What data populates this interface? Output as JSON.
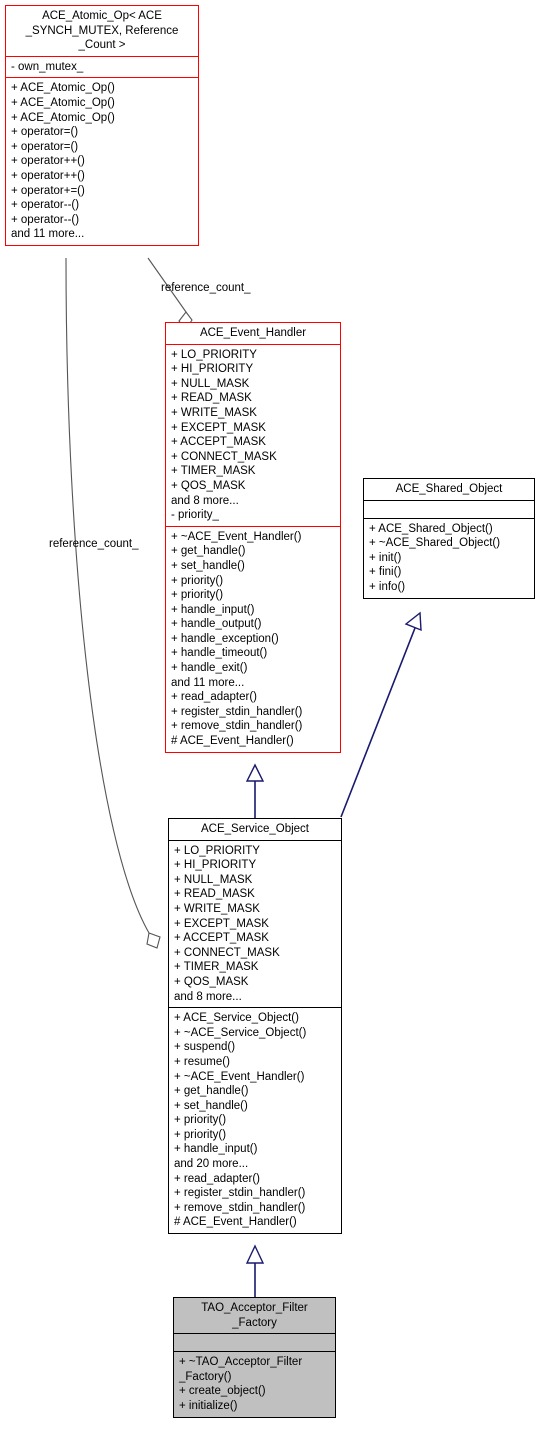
{
  "diagram": {
    "type": "uml-class-inheritance-collaboration",
    "background": "#ffffff",
    "highlight_border_color": "#ff0000",
    "normal_border_color": "#000000",
    "focus_fill_color": "#c0c0c0",
    "inheritance_edge_color": "#191970",
    "aggregation_edge_color": "#555555"
  },
  "classes": {
    "atomic_op": {
      "name": "ACE_Atomic_Op< ACE\n_SYNCH_MUTEX, Reference\n_Count >",
      "attributes": [
        "- own_mutex_"
      ],
      "operations": [
        "+ ACE_Atomic_Op()",
        "+ ACE_Atomic_Op()",
        "+ ACE_Atomic_Op()",
        "+ operator=()",
        "+ operator=()",
        "+ operator++()",
        "+ operator++()",
        "+ operator+=()",
        "+ operator--()",
        "+ operator--()",
        "and 11 more..."
      ]
    },
    "event_handler": {
      "name": "ACE_Event_Handler",
      "attributes": [
        "+ LO_PRIORITY",
        "+ HI_PRIORITY",
        "+ NULL_MASK",
        "+ READ_MASK",
        "+ WRITE_MASK",
        "+ EXCEPT_MASK",
        "+ ACCEPT_MASK",
        "+ CONNECT_MASK",
        "+ TIMER_MASK",
        "+ QOS_MASK",
        "and 8 more...",
        "- priority_"
      ],
      "operations": [
        "+ ~ACE_Event_Handler()",
        "+ get_handle()",
        "+ set_handle()",
        "+ priority()",
        "+ priority()",
        "+ handle_input()",
        "+ handle_output()",
        "+ handle_exception()",
        "+ handle_timeout()",
        "+ handle_exit()",
        "and 11 more...",
        "+ read_adapter()",
        "+ register_stdin_handler()",
        "+ remove_stdin_handler()",
        "# ACE_Event_Handler()"
      ]
    },
    "shared_object": {
      "name": "ACE_Shared_Object",
      "attributes": [],
      "operations": [
        "+ ACE_Shared_Object()",
        "+ ~ACE_Shared_Object()",
        "+ init()",
        "+ fini()",
        "+ info()"
      ]
    },
    "service_object": {
      "name": "ACE_Service_Object",
      "attributes": [
        "+ LO_PRIORITY",
        "+ HI_PRIORITY",
        "+ NULL_MASK",
        "+ READ_MASK",
        "+ WRITE_MASK",
        "+ EXCEPT_MASK",
        "+ ACCEPT_MASK",
        "+ CONNECT_MASK",
        "+ TIMER_MASK",
        "+ QOS_MASK",
        "and 8 more..."
      ],
      "operations": [
        "+ ACE_Service_Object()",
        "+ ~ACE_Service_Object()",
        "+ suspend()",
        "+ resume()",
        "+ ~ACE_Event_Handler()",
        "+ get_handle()",
        "+ set_handle()",
        "+ priority()",
        "+ priority()",
        "+ handle_input()",
        "and 20 more...",
        "+ read_adapter()",
        "+ register_stdin_handler()",
        "+ remove_stdin_handler()",
        "# ACE_Event_Handler()"
      ]
    },
    "acceptor_filter_factory": {
      "name": "TAO_Acceptor_Filter\n_Factory",
      "attributes": [],
      "operations": [
        "+ ~TAO_Acceptor_Filter\n_Factory()",
        "+ create_object()",
        "+ initialize()"
      ]
    }
  },
  "edge_labels": {
    "ref_count_top": "reference_count_",
    "ref_count_bottom": "reference_count_"
  }
}
